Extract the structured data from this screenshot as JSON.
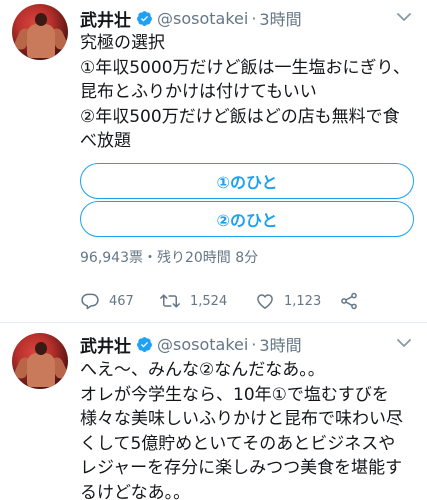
{
  "tweets": [
    {
      "author": {
        "name": "武井壮",
        "handle": "@sosotakei",
        "separator": "·",
        "time": "3時間"
      },
      "lines": [
        "究極の選択",
        "①年収5000万だけど飯は一生塩おにぎり、",
        "昆布とふりかけは付けてもいい",
        "②年収500万だけど飯はどの店も無料で食",
        "べ放題"
      ],
      "poll": {
        "options": [
          "①のひと",
          "②のひと"
        ],
        "meta": "96,943票・残り20時間 8分"
      },
      "actions": {
        "reply_count": "467",
        "retweet_count": "1,524",
        "like_count": "1,123"
      }
    },
    {
      "author": {
        "name": "武井壮",
        "handle": "@sosotakei",
        "separator": "·",
        "time": "3時間"
      },
      "lines": [
        "へえ〜、みんな②なんだなあ。。",
        "オレが今学生なら、10年①で塩むすびを",
        "様々な美味しいふりかけと昆布で味わい尽",
        "くして5億貯めといてそのあとビジネスや",
        "レジャーを存分に楽しみつつ美食を堪能す",
        "るけどなあ。。"
      ]
    }
  ],
  "colors": {
    "accent": "#1da1f2",
    "secondary_text": "#657786",
    "primary_text": "#14171a"
  },
  "icons": [
    "verified-badge-icon",
    "chevron-down-icon",
    "reply-icon",
    "retweet-icon",
    "like-icon",
    "share-icon"
  ]
}
